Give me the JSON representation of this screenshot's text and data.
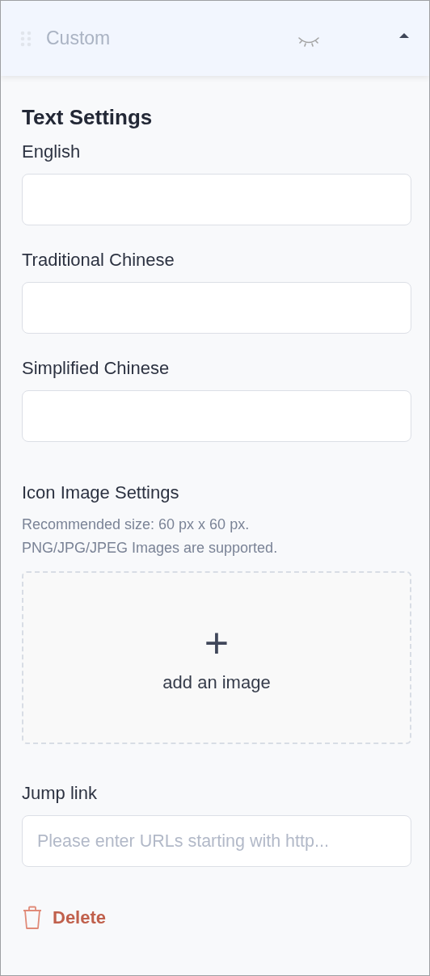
{
  "header": {
    "title": "Custom",
    "visible": false,
    "expanded": true
  },
  "section_title": "Text Settings",
  "text_fields": [
    {
      "label": "English"
    },
    {
      "label": "Traditional Chinese"
    },
    {
      "label": "Simplified Chinese"
    }
  ],
  "icon_image": {
    "label": "Icon Image Settings",
    "hints": [
      "Recommended size: 60 px x 60 px.",
      "PNG/JPG/JPEG Images are supported."
    ],
    "upload": {
      "plus": "+",
      "label": "add an image"
    }
  },
  "jump_link": {
    "label": "Jump link",
    "placeholder": "Please enter URLs starting with http..."
  },
  "delete_button": "Delete"
}
